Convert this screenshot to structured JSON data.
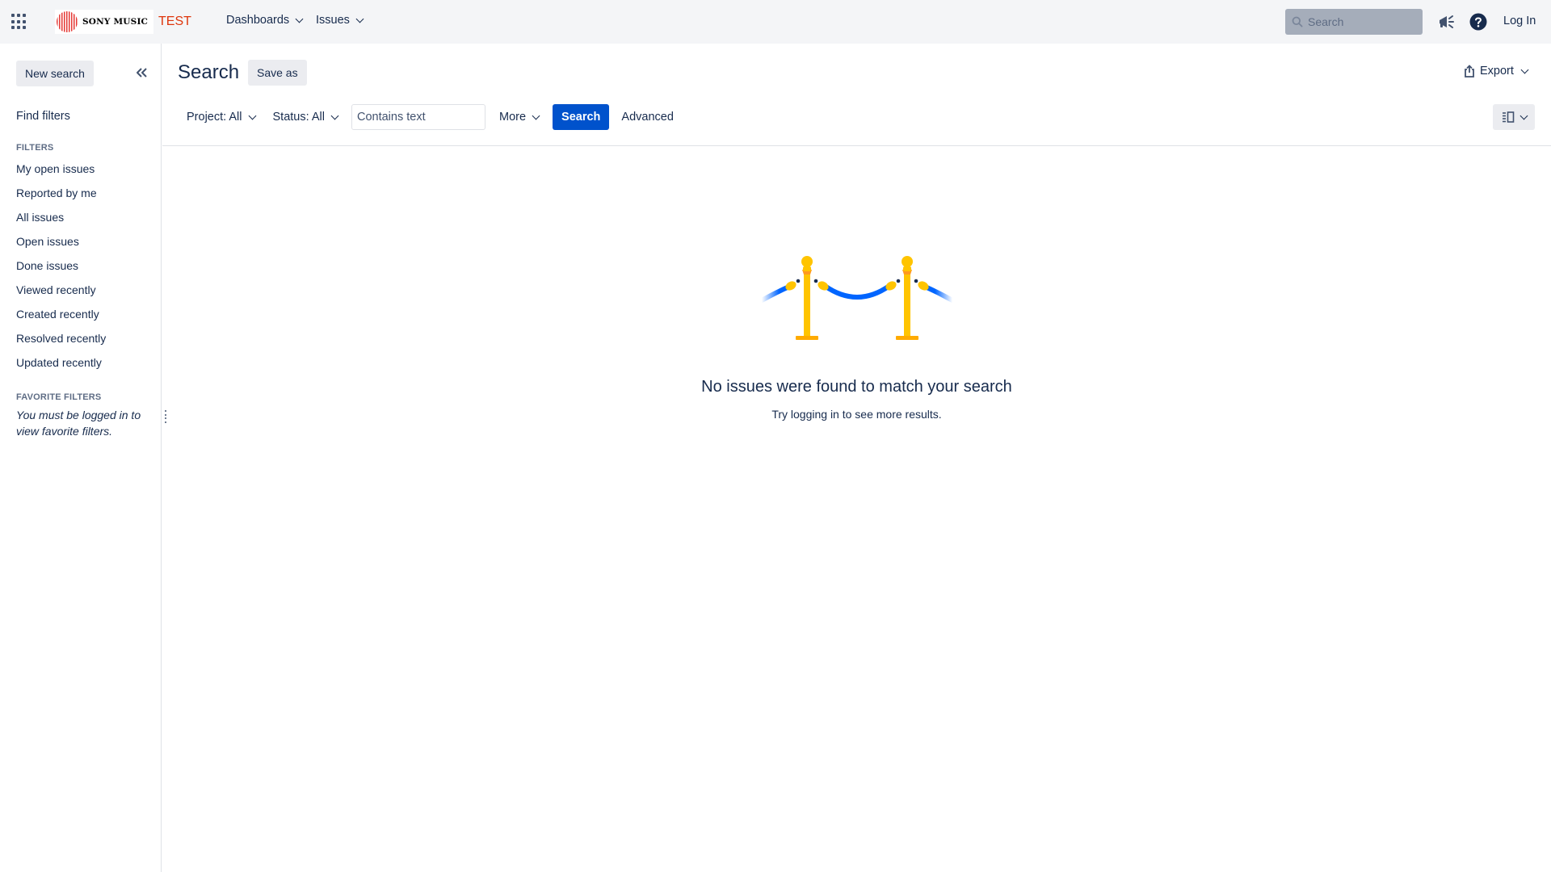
{
  "topnav": {
    "logo_text": "SONY MUSIC",
    "env_label": "TEST",
    "menu": [
      {
        "label": "Dashboards"
      },
      {
        "label": "Issues"
      }
    ],
    "search_placeholder": "Search",
    "login_label": "Log In",
    "icons": [
      "app-switcher-icon",
      "megaphone-icon",
      "help-icon"
    ]
  },
  "sidebar": {
    "new_search_label": "New search",
    "find_filters_label": "Find filters",
    "filters_heading": "FILTERS",
    "filters": [
      "My open issues",
      "Reported by me",
      "All issues",
      "Open issues",
      "Done issues",
      "Viewed recently",
      "Created recently",
      "Resolved recently",
      "Updated recently"
    ],
    "favorite_heading": "FAVORITE FILTERS",
    "favorite_note": "You must be logged in to view favorite filters."
  },
  "main": {
    "title": "Search",
    "save_as_label": "Save as",
    "export_label": "Export",
    "toolbar": {
      "project_label": "Project: All",
      "status_label": "Status: All",
      "contains_placeholder": "Contains text",
      "more_label": "More",
      "search_button": "Search",
      "advanced_label": "Advanced"
    },
    "empty_state": {
      "title": "No issues were found to match your search",
      "subtitle": "Try logging in to see more results."
    }
  },
  "colors": {
    "primary": "#0052cc",
    "env_label": "#de350b",
    "post_yellow": "#ffc400",
    "rope_blue": "#0065ff"
  }
}
